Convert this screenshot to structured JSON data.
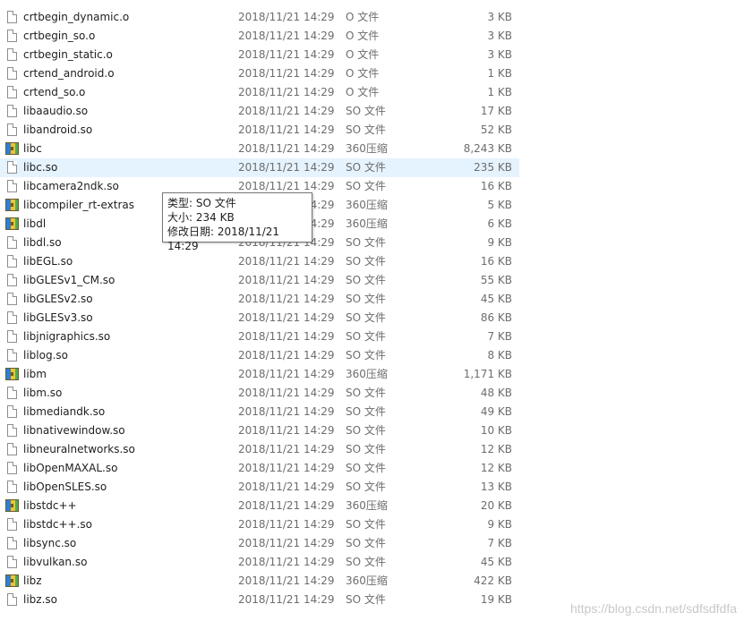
{
  "files": [
    {
      "name": "crtbegin_dynamic.o",
      "date": "2018/11/21 14:29",
      "type": "O 文件",
      "size": "3 KB",
      "icon": "file-icon"
    },
    {
      "name": "crtbegin_so.o",
      "date": "2018/11/21 14:29",
      "type": "O 文件",
      "size": "3 KB",
      "icon": "file-icon"
    },
    {
      "name": "crtbegin_static.o",
      "date": "2018/11/21 14:29",
      "type": "O 文件",
      "size": "3 KB",
      "icon": "file-icon"
    },
    {
      "name": "crtend_android.o",
      "date": "2018/11/21 14:29",
      "type": "O 文件",
      "size": "1 KB",
      "icon": "file-icon"
    },
    {
      "name": "crtend_so.o",
      "date": "2018/11/21 14:29",
      "type": "O 文件",
      "size": "1 KB",
      "icon": "file-icon"
    },
    {
      "name": "libaaudio.so",
      "date": "2018/11/21 14:29",
      "type": "SO 文件",
      "size": "17 KB",
      "icon": "file-icon"
    },
    {
      "name": "libandroid.so",
      "date": "2018/11/21 14:29",
      "type": "SO 文件",
      "size": "52 KB",
      "icon": "file-icon"
    },
    {
      "name": "libc",
      "date": "2018/11/21 14:29",
      "type": "360压缩",
      "size": "8,243 KB",
      "icon": "archive-icon"
    },
    {
      "name": "libc.so",
      "date": "2018/11/21 14:29",
      "type": "SO 文件",
      "size": "235 KB",
      "icon": "file-icon",
      "hovered": true
    },
    {
      "name": "libcamera2ndk.so",
      "date": "2018/11/21 14:29",
      "type": "SO 文件",
      "size": "16 KB",
      "icon": "file-icon"
    },
    {
      "name": "libcompiler_rt-extras",
      "date": "2018/11/21 14:29",
      "type": "360压缩",
      "size": "5 KB",
      "icon": "archive-icon"
    },
    {
      "name": "libdl",
      "date": "2018/11/21 14:29",
      "type": "360压缩",
      "size": "6 KB",
      "icon": "archive-icon"
    },
    {
      "name": "libdl.so",
      "date": "2018/11/21 14:29",
      "type": "SO 文件",
      "size": "9 KB",
      "icon": "file-icon"
    },
    {
      "name": "libEGL.so",
      "date": "2018/11/21 14:29",
      "type": "SO 文件",
      "size": "16 KB",
      "icon": "file-icon"
    },
    {
      "name": "libGLESv1_CM.so",
      "date": "2018/11/21 14:29",
      "type": "SO 文件",
      "size": "55 KB",
      "icon": "file-icon"
    },
    {
      "name": "libGLESv2.so",
      "date": "2018/11/21 14:29",
      "type": "SO 文件",
      "size": "45 KB",
      "icon": "file-icon"
    },
    {
      "name": "libGLESv3.so",
      "date": "2018/11/21 14:29",
      "type": "SO 文件",
      "size": "86 KB",
      "icon": "file-icon"
    },
    {
      "name": "libjnigraphics.so",
      "date": "2018/11/21 14:29",
      "type": "SO 文件",
      "size": "7 KB",
      "icon": "file-icon"
    },
    {
      "name": "liblog.so",
      "date": "2018/11/21 14:29",
      "type": "SO 文件",
      "size": "8 KB",
      "icon": "file-icon"
    },
    {
      "name": "libm",
      "date": "2018/11/21 14:29",
      "type": "360压缩",
      "size": "1,171 KB",
      "icon": "archive-icon"
    },
    {
      "name": "libm.so",
      "date": "2018/11/21 14:29",
      "type": "SO 文件",
      "size": "48 KB",
      "icon": "file-icon"
    },
    {
      "name": "libmediandk.so",
      "date": "2018/11/21 14:29",
      "type": "SO 文件",
      "size": "49 KB",
      "icon": "file-icon"
    },
    {
      "name": "libnativewindow.so",
      "date": "2018/11/21 14:29",
      "type": "SO 文件",
      "size": "10 KB",
      "icon": "file-icon"
    },
    {
      "name": "libneuralnetworks.so",
      "date": "2018/11/21 14:29",
      "type": "SO 文件",
      "size": "12 KB",
      "icon": "file-icon"
    },
    {
      "name": "libOpenMAXAL.so",
      "date": "2018/11/21 14:29",
      "type": "SO 文件",
      "size": "12 KB",
      "icon": "file-icon"
    },
    {
      "name": "libOpenSLES.so",
      "date": "2018/11/21 14:29",
      "type": "SO 文件",
      "size": "13 KB",
      "icon": "file-icon"
    },
    {
      "name": "libstdc++",
      "date": "2018/11/21 14:29",
      "type": "360压缩",
      "size": "20 KB",
      "icon": "archive-icon"
    },
    {
      "name": "libstdc++.so",
      "date": "2018/11/21 14:29",
      "type": "SO 文件",
      "size": "9 KB",
      "icon": "file-icon"
    },
    {
      "name": "libsync.so",
      "date": "2018/11/21 14:29",
      "type": "SO 文件",
      "size": "7 KB",
      "icon": "file-icon"
    },
    {
      "name": "libvulkan.so",
      "date": "2018/11/21 14:29",
      "type": "SO 文件",
      "size": "45 KB",
      "icon": "file-icon"
    },
    {
      "name": "libz",
      "date": "2018/11/21 14:29",
      "type": "360压缩",
      "size": "422 KB",
      "icon": "archive-icon"
    },
    {
      "name": "libz.so",
      "date": "2018/11/21 14:29",
      "type": "SO 文件",
      "size": "19 KB",
      "icon": "file-icon"
    }
  ],
  "tooltip": {
    "line1": "类型: SO 文件",
    "line2": "大小: 234 KB",
    "line3": "修改日期: 2018/11/21 14:29"
  },
  "watermark": "https://blog.csdn.net/sdfsdfdfa",
  "colors": {
    "hover_bg": "#e5f3ff",
    "secondary_text": "#6d6d6d"
  }
}
